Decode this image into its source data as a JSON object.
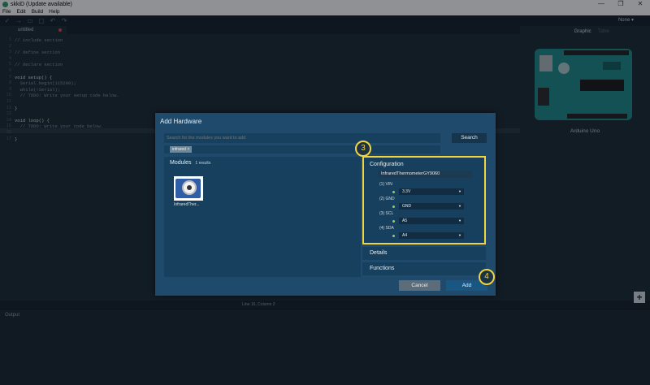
{
  "window": {
    "title": "skkiD (Update available)",
    "controls": [
      "—",
      "❐",
      "✕"
    ]
  },
  "menu": [
    "File",
    "Edit",
    "Build",
    "Help"
  ],
  "toolbar": {
    "board_selector": "None ▾"
  },
  "editor": {
    "tab_label": "untitled",
    "line_numbers": [
      "1",
      "2",
      "3",
      "4",
      "5",
      "6",
      "7",
      "8",
      "9",
      "10",
      "11",
      "12",
      "13",
      "14",
      "15",
      "16",
      "17"
    ],
    "code_lines": [
      "// include section",
      "",
      "// define section",
      "",
      "// declare section",
      "",
      "void setup() {",
      "  Serial.begin(115200);",
      "  while(!Serial);",
      "  // TODO: Write your setup code below.",
      "",
      "}",
      "",
      "void loop() {",
      "  // TODO: Write your code below.",
      "",
      "}"
    ]
  },
  "right_panel": {
    "view_tabs": [
      "Graphic",
      "Table"
    ],
    "board_name": "Arduino Uno"
  },
  "status_bar": "Line 16, Column 2",
  "output_label": "Output",
  "dialog": {
    "title": "Add Hardware",
    "search_placeholder": "Search for the modules you want to add",
    "search_button": "Search",
    "filter_tag": "infrared ×",
    "modules_title": "Modules",
    "modules_count": "1 results",
    "module_name": "InfraredTher...",
    "configuration": {
      "title": "Configuration",
      "name_value": "InfraredThermometerGY9060",
      "pins": [
        {
          "label": "(1) VIN",
          "value": "3.3V"
        },
        {
          "label": "(2) GND",
          "value": "GND"
        },
        {
          "label": "(3) SCL",
          "value": "A5"
        },
        {
          "label": "(4) SDA",
          "value": "A4"
        }
      ]
    },
    "details_label": "Details",
    "functions_label": "Functions",
    "cancel_button": "Cancel",
    "add_button": "Add"
  },
  "callouts": {
    "step3": "3",
    "step4": "4"
  },
  "colors": {
    "dialog_bg": "#1f4a6b",
    "highlight": "#f2d53c",
    "pin_connected": "#9bd23b"
  }
}
